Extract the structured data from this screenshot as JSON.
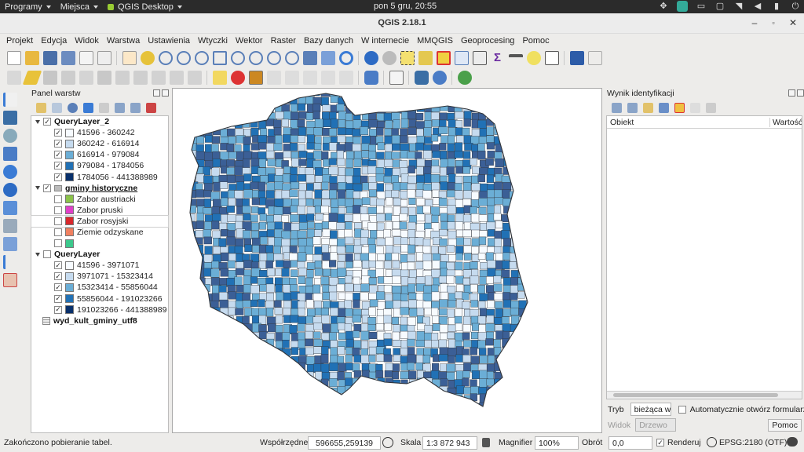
{
  "top_panel": {
    "apps_menu": "Programy",
    "places_menu": "Miejsca",
    "app_menu": "QGIS Desktop",
    "clock": "pon  5 gru, 20:55"
  },
  "window": {
    "title": "QGIS 2.18.1"
  },
  "menubar": [
    "Projekt",
    "Edycja",
    "Widok",
    "Warstwa",
    "Ustawienia",
    "Wtyczki",
    "Wektor",
    "Raster",
    "Bazy danych",
    "W internecie",
    "MMQGIS",
    "Geoprocesing",
    "Pomoc"
  ],
  "layers_panel": {
    "title": "Panel warstw",
    "groups": [
      {
        "name": "QueryLayer_2",
        "checked": true,
        "classes": [
          {
            "label": "41596 - 360242",
            "color": "#f7fbff"
          },
          {
            "label": "360242 - 616914",
            "color": "#c6dbef"
          },
          {
            "label": "616914 - 979084",
            "color": "#6baed6"
          },
          {
            "label": "979084 - 1784056",
            "color": "#2171b5"
          },
          {
            "label": "1784056 - 441388989",
            "color": "#08306b"
          }
        ]
      },
      {
        "name": "gminy historyczne",
        "checked": true,
        "classes": [
          {
            "label": "Zabor austriacki",
            "color": "#8bc34a"
          },
          {
            "label": "Zabor pruski",
            "color": "#e040c8"
          },
          {
            "label": "Zabor rosyjski",
            "color": "#d8282c"
          },
          {
            "label": "Ziemie odzyskane",
            "color": "#f08060"
          },
          {
            "label": "",
            "color": "#3cc88c"
          }
        ]
      },
      {
        "name": "QueryLayer",
        "checked": false,
        "classes": [
          {
            "label": "41596 - 3971071",
            "color": "#f7fbff"
          },
          {
            "label": "3971071 - 15323414",
            "color": "#c6dbef"
          },
          {
            "label": "15323414 - 55856044",
            "color": "#6baed6"
          },
          {
            "label": "55856044 - 191023266",
            "color": "#2171b5"
          },
          {
            "label": "191023266 - 441388989",
            "color": "#08306b"
          }
        ]
      }
    ],
    "table_layer": "wyd_kult_gminy_utf8"
  },
  "identify_panel": {
    "title": "Wynik identyfikacji",
    "col_object": "Obiekt",
    "col_value": "Wartość",
    "mode_label": "Tryb",
    "mode_value": "bieżąca w",
    "auto_open_label": "Automatycznie otwórz formularz",
    "view_label": "Widok",
    "view_value": "Drzewo",
    "help_button": "Pomoc"
  },
  "statusbar": {
    "message": "Zakończono pobieranie tabel.",
    "coord_label": "Współrzędne",
    "coord_value": "596655,259139",
    "scale_label": "Skala",
    "scale_value": "1:3 872 943",
    "magnifier_label": "Magnifier",
    "magnifier_value": "100%",
    "rotation_label": "Obrót",
    "rotation_value": "0,0",
    "render_label": "Renderuj",
    "crs": "EPSG:2180 (OTF)"
  },
  "colors": {
    "ramp": [
      "#f7fbff",
      "#c6dbef",
      "#6baed6",
      "#2171b5",
      "#08306b"
    ],
    "boundary": "#30343a"
  }
}
